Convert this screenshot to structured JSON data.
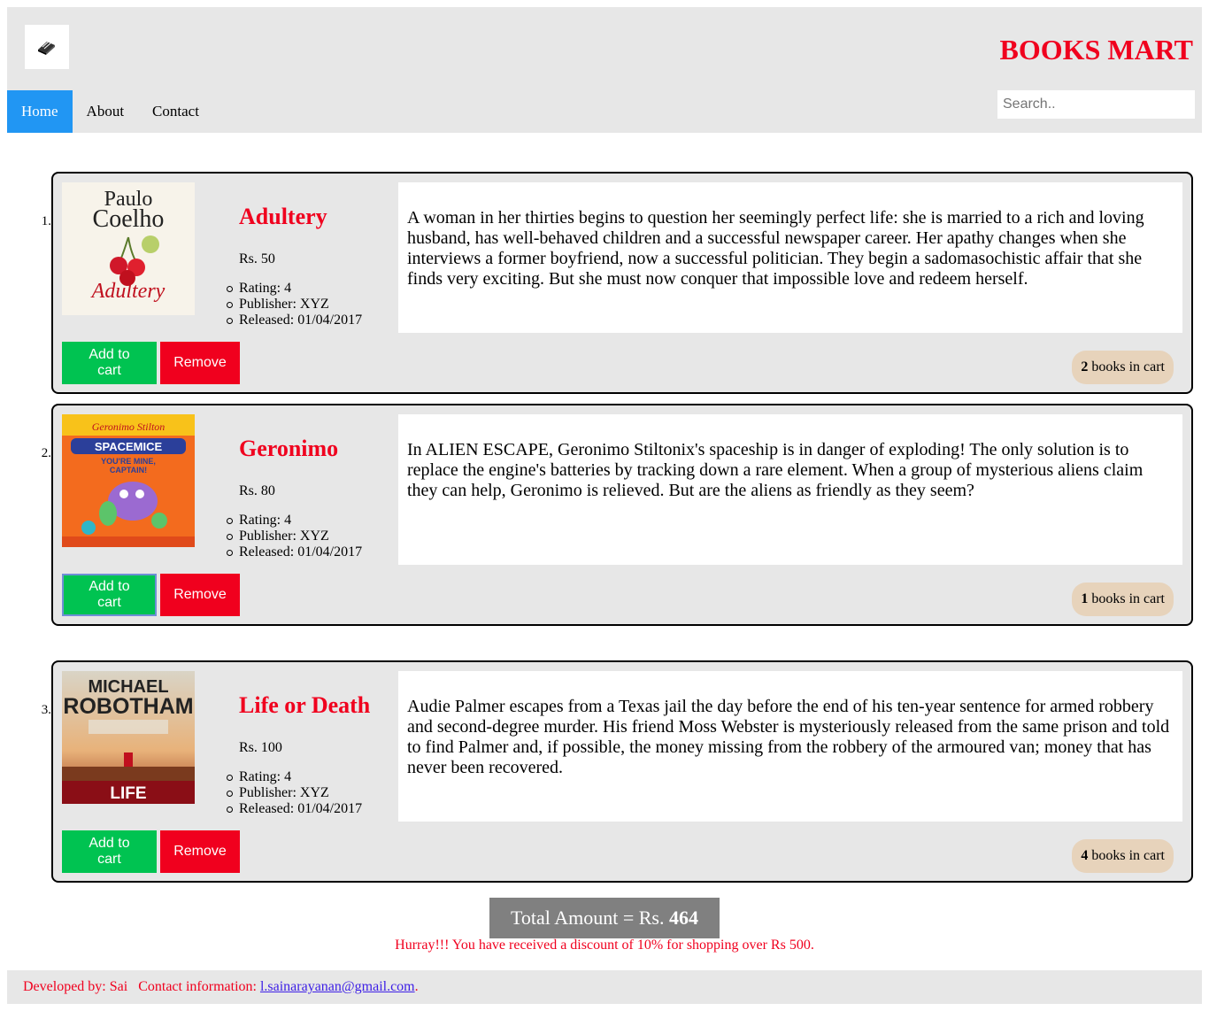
{
  "header": {
    "brand": "BOOKS MART",
    "logo_icon": "book-logo-icon",
    "nav": [
      {
        "label": "Home",
        "active": true
      },
      {
        "label": "About",
        "active": false
      },
      {
        "label": "Contact",
        "active": false
      }
    ],
    "search_placeholder": "Search.."
  },
  "books": [
    {
      "number": "1.",
      "title": "Adultery",
      "price": "Rs. 50",
      "rating": "Rating: 4",
      "publisher": "Publisher: XYZ",
      "released": "Released: 01/04/2017",
      "cover_author": "Paulo Coelho",
      "cover_title": "Adultery",
      "description": "A woman in her thirties begins to question her seemingly perfect life: she is married to a rich and loving husband, has well-behaved children and a successful newspaper career. Her apathy changes when she interviews a former boyfriend, now a successful politician. They begin a sadomasochistic affair that she finds very exciting. But she must now conquer that impossible love and redeem herself.",
      "add_label": "Add to cart",
      "remove_label": "Remove",
      "cart_count": "2",
      "cart_suffix": " books in cart"
    },
    {
      "number": "2.",
      "title": "Geronimo",
      "price": "Rs. 80",
      "rating": "Rating: 4",
      "publisher": "Publisher: XYZ",
      "released": "Released: 01/04/2017",
      "cover_author": "Geronimo Stilton",
      "cover_title": "SPACEMICE",
      "cover_subtitle": "YOU'RE MINE, CAPTAIN!",
      "description": "In ALIEN ESCAPE, Geronimo Stiltonix's spaceship is in danger of exploding! The only solution is to replace the engine's batteries by tracking down a rare element. When a group of mysterious aliens claim they can help, Geronimo is relieved. But are the aliens as friendly as they seem?",
      "add_label": "Add to cart",
      "remove_label": "Remove",
      "cart_count": "1",
      "cart_suffix": " books in cart"
    },
    {
      "number": "3.",
      "title": "Life or Death",
      "price": "Rs. 100",
      "rating": "Rating: 4",
      "publisher": "Publisher: XYZ",
      "released": "Released: 01/04/2017",
      "cover_author": "MICHAEL ROBOTHAM",
      "cover_title": "LIFE OR DEATH",
      "description": "Audie Palmer escapes from a Texas jail the day before the end of his ten-year sentence for armed robbery and second-degree murder. His friend Moss Webster is mysteriously released from the same prison and told to find Palmer and, if possible, the money missing from the robbery of the armoured van; money that has never been recovered.",
      "add_label": "Add to cart",
      "remove_label": "Remove",
      "cart_count": "4",
      "cart_suffix": " books in cart"
    }
  ],
  "total": {
    "prefix": "Total Amount = Rs. ",
    "amount": "464"
  },
  "discount_message": "Hurray!!! You have received a discount of 10% for shopping over Rs 500.",
  "footer": {
    "developer": "Developed by: Sai",
    "contact_label": "Contact information:",
    "email": "l.sainarayanan@gmail.com",
    "trailing": "."
  },
  "colors": {
    "brand_red": "#f0001e",
    "nav_active": "#2196f3",
    "add_green": "#00c351",
    "total_grey": "#808080",
    "badge_tan": "#e7d3bb"
  }
}
